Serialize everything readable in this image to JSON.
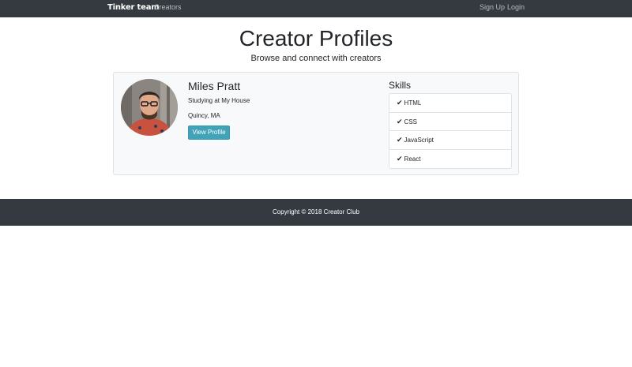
{
  "navbar": {
    "brand": "Tinker team",
    "links": {
      "creators": "Creators",
      "signup": "Sign Up",
      "login": "Login"
    },
    "bg_color": "#343a40"
  },
  "header": {
    "title": "Creator Profiles",
    "subtitle": "Browse and connect with creators"
  },
  "profile": {
    "name": "Miles Pratt",
    "school": "Studying at My House",
    "location": "Quincy, MA",
    "button_label": "View Profile",
    "button_color": "#41a3b8",
    "skills_title": "Skills",
    "skills": [
      "HTML",
      "CSS",
      "JavaScript",
      "React"
    ],
    "skill_icon": "check-icon"
  },
  "footer": {
    "text": "Copyright © 2018 Creator Club"
  }
}
